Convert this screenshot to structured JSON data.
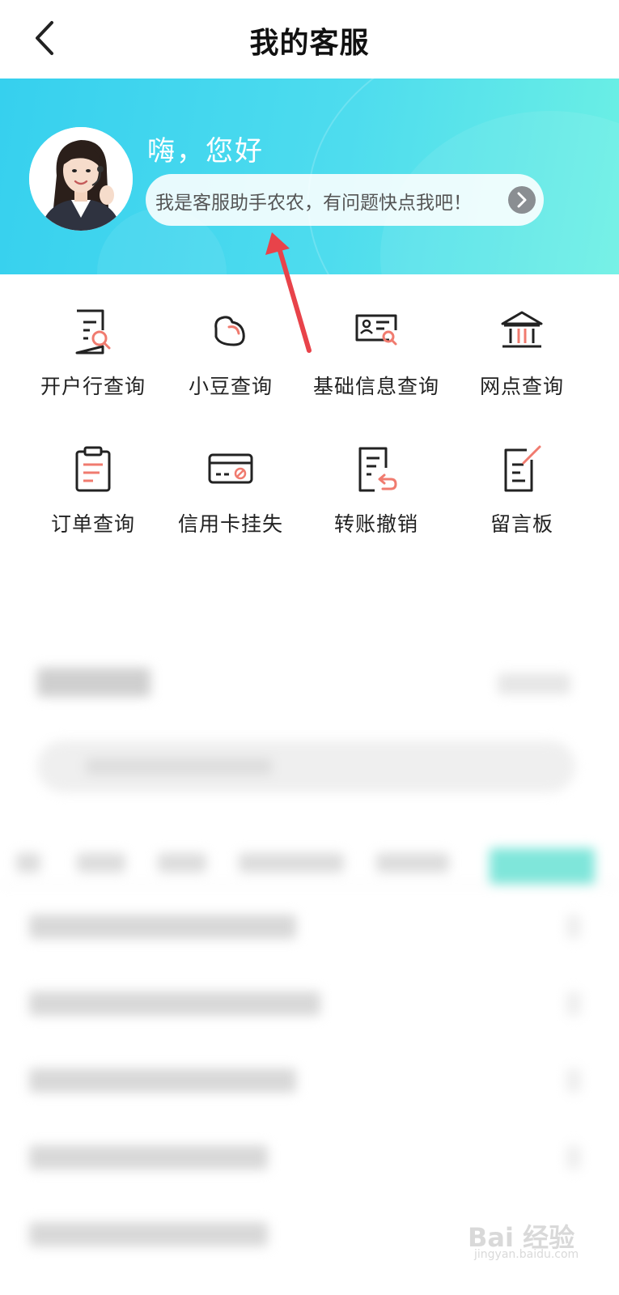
{
  "header": {
    "title": "我的客服"
  },
  "banner": {
    "greeting": "嗨，您好",
    "helper_text": "我是客服助手农农，有问题快点我吧！"
  },
  "services": [
    {
      "label": "开户行查询",
      "icon": "doc-search-icon"
    },
    {
      "label": "小豆查询",
      "icon": "bean-icon"
    },
    {
      "label": "基础信息查询",
      "icon": "id-card-search-icon"
    },
    {
      "label": "网点查询",
      "icon": "bank-building-icon"
    },
    {
      "label": "订单查询",
      "icon": "clipboard-icon"
    },
    {
      "label": "信用卡挂失",
      "icon": "card-blocked-icon"
    },
    {
      "label": "转账撤销",
      "icon": "doc-undo-icon"
    },
    {
      "label": "留言板",
      "icon": "note-pen-icon"
    }
  ],
  "colors": {
    "banner_start": "#36d0ee",
    "banner_end": "#6cf0e4",
    "icon_accent": "#f07b6f",
    "annotation_arrow": "#e8434a"
  },
  "watermark": {
    "brand": "Bai 经验",
    "url": "jingyan.baidu.com"
  }
}
